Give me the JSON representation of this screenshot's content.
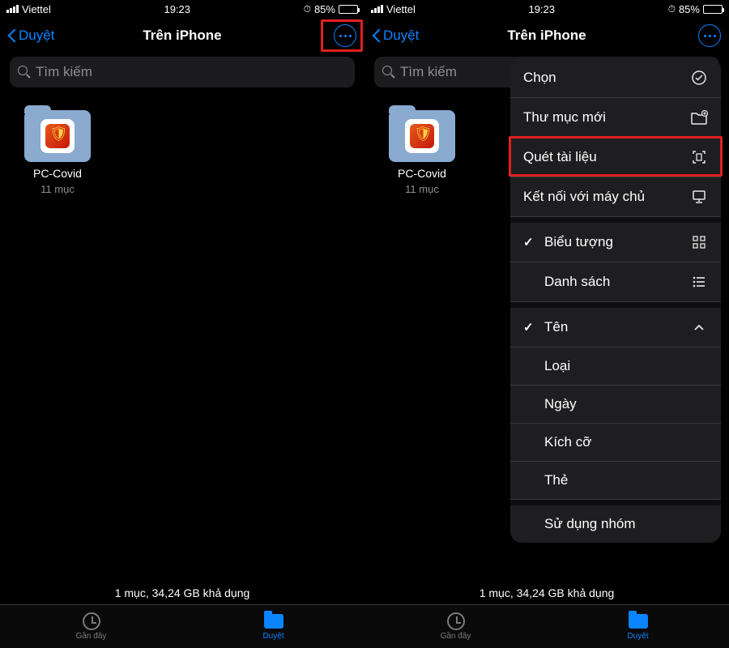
{
  "status": {
    "carrier": "Viettel",
    "time": "19:23",
    "battery_pct": "85%"
  },
  "nav": {
    "back_label": "Duyệt",
    "title": "Trên iPhone"
  },
  "search": {
    "placeholder": "Tìm kiếm"
  },
  "folder": {
    "name": "PC-Covid",
    "meta": "11 mục"
  },
  "footer": {
    "storage": "1 mục, 34,24 GB khả dụng"
  },
  "tabs": {
    "recent": "Gần đây",
    "browse": "Duyệt"
  },
  "menu": {
    "select": "Chọn",
    "new_folder": "Thư mục mới",
    "scan": "Quét tài liệu",
    "connect": "Kết nối với máy chủ",
    "icons_view": "Biểu tượng",
    "list_view": "Danh sách",
    "sort_name": "Tên",
    "sort_kind": "Loại",
    "sort_date": "Ngày",
    "sort_size": "Kích cỡ",
    "sort_tags": "Thẻ",
    "groups": "Sử dụng nhóm"
  }
}
